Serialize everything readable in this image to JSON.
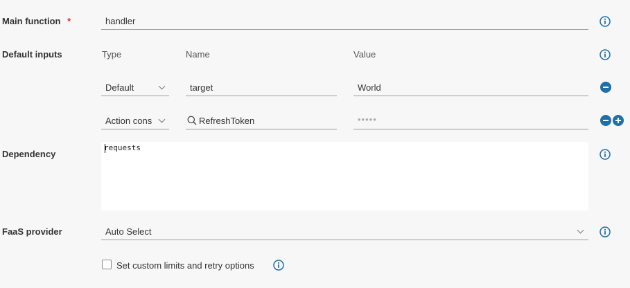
{
  "main_function": {
    "label": "Main function",
    "required_mark": "*",
    "value": "handler"
  },
  "default_inputs": {
    "label": "Default inputs",
    "columns": {
      "type": "Type",
      "name": "Name",
      "value": "Value"
    },
    "rows": [
      {
        "type": "Default",
        "name": "target",
        "value": "World"
      },
      {
        "type": "Action cons",
        "name": "RefreshToken",
        "value": "•••••"
      }
    ]
  },
  "dependency": {
    "label": "Dependency",
    "value": "requests"
  },
  "faas_provider": {
    "label": "FaaS provider",
    "value": "Auto Select"
  },
  "custom_limits": {
    "label": "Set custom limits and retry options",
    "checked": false
  },
  "colors": {
    "accent": "#1f6fa8",
    "required": "#d9302b"
  },
  "icons": {
    "info": "info-icon",
    "remove": "minus-circle-icon",
    "add": "plus-circle-icon",
    "search": "search-icon",
    "dropdown": "chevron-down-icon"
  }
}
